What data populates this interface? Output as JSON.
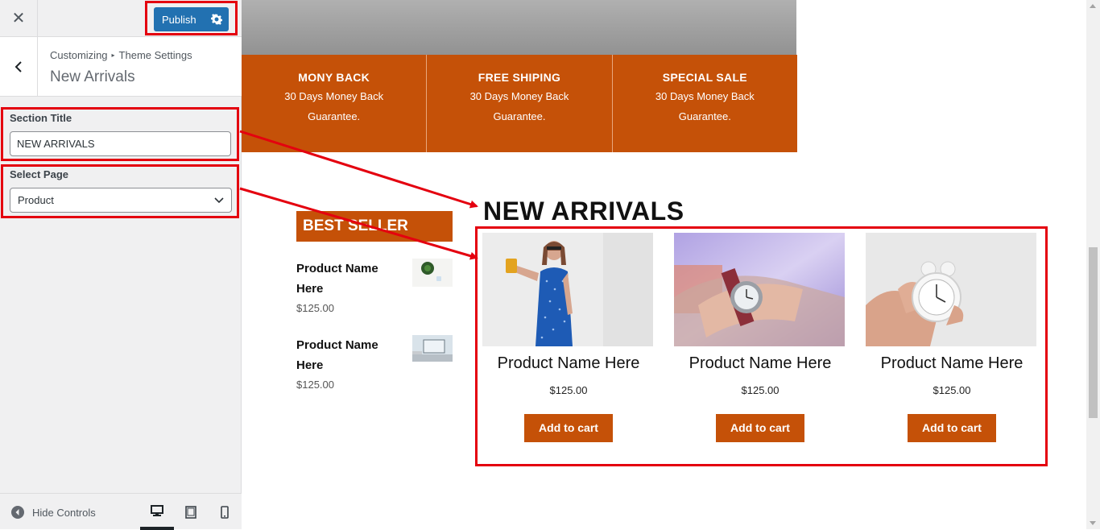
{
  "customizer": {
    "publish_label": "Publish",
    "breadcrumb": {
      "parent": "Customizing",
      "current": "Theme Settings"
    },
    "section_title": "New Arrivals",
    "fields": {
      "section_title_label": "Section Title",
      "section_title_value": "NEW ARRIVALS",
      "select_page_label": "Select Page",
      "select_page_value": "Product"
    },
    "footer": {
      "hide_controls": "Hide Controls"
    }
  },
  "preview": {
    "features": [
      {
        "title": "MONY BACK",
        "desc": "30 Days Money Back Guarantee."
      },
      {
        "title": "FREE SHIPING",
        "desc": "30 Days Money Back Guarantee."
      },
      {
        "title": "SPECIAL SALE",
        "desc": "30 Days Money Back Guarantee."
      }
    ],
    "best_seller": {
      "title": "BEST SELLER",
      "items": [
        {
          "name": "Product Name Here",
          "price": "$125.00"
        },
        {
          "name": "Product Name Here",
          "price": "$125.00"
        }
      ]
    },
    "new_arrivals": {
      "title": "NEW ARRIVALS",
      "products": [
        {
          "name": "Product Name Here",
          "price": "$125.00",
          "button": "Add to cart"
        },
        {
          "name": "Product Name Here",
          "price": "$125.00",
          "button": "Add to cart"
        },
        {
          "name": "Product Name Here",
          "price": "$125.00",
          "button": "Add to cart"
        }
      ]
    }
  },
  "colors": {
    "accent": "#c55108",
    "publish": "#2271b1",
    "annotation": "#e4000f"
  }
}
